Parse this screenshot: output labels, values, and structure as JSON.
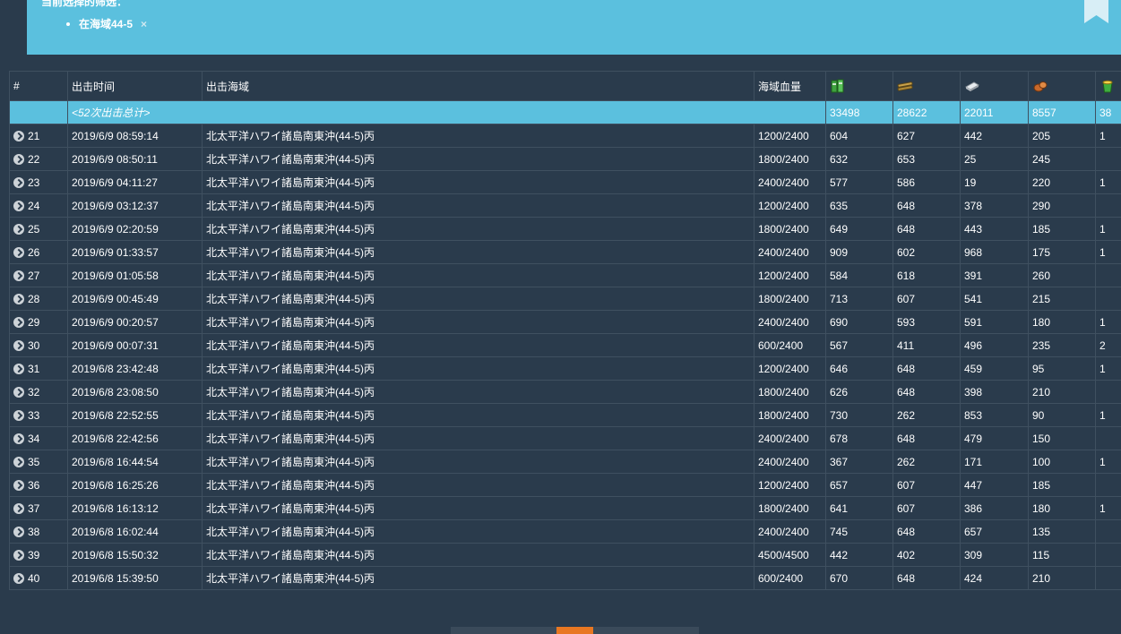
{
  "filter": {
    "title": "当前选择的筛选：",
    "items": [
      {
        "label": "在海域44-5",
        "remove": "×"
      }
    ]
  },
  "table": {
    "headers": {
      "index": "#",
      "time": "出击时间",
      "map": "出击海域",
      "hp": "海域血量",
      "fuel_icon": "fuel-icon",
      "ammo_icon": "ammo-icon",
      "steel_icon": "steel-icon",
      "bauxite_icon": "bauxite-icon",
      "bucket_icon": "bucket-icon"
    },
    "summary": {
      "label": "<52次出击总计>",
      "fuel": "33498",
      "ammo": "28622",
      "steel": "22011",
      "bauxite": "8557",
      "bucket": "38"
    },
    "rows": [
      {
        "index": "21",
        "time": "2019/6/9 08:59:14",
        "map": "北太平洋ハワイ諸島南東沖(44-5)丙",
        "hp": "1200/2400",
        "fuel": "604",
        "ammo": "627",
        "steel": "442",
        "bauxite": "205",
        "bucket": "1"
      },
      {
        "index": "22",
        "time": "2019/6/9 08:50:11",
        "map": "北太平洋ハワイ諸島南東沖(44-5)丙",
        "hp": "1800/2400",
        "fuel": "632",
        "ammo": "653",
        "steel": "25",
        "bauxite": "245",
        "bucket": ""
      },
      {
        "index": "23",
        "time": "2019/6/9 04:11:27",
        "map": "北太平洋ハワイ諸島南東沖(44-5)丙",
        "hp": "2400/2400",
        "fuel": "577",
        "ammo": "586",
        "steel": "19",
        "bauxite": "220",
        "bucket": "1"
      },
      {
        "index": "24",
        "time": "2019/6/9 03:12:37",
        "map": "北太平洋ハワイ諸島南東沖(44-5)丙",
        "hp": "1200/2400",
        "fuel": "635",
        "ammo": "648",
        "steel": "378",
        "bauxite": "290",
        "bucket": ""
      },
      {
        "index": "25",
        "time": "2019/6/9 02:20:59",
        "map": "北太平洋ハワイ諸島南東沖(44-5)丙",
        "hp": "1800/2400",
        "fuel": "649",
        "ammo": "648",
        "steel": "443",
        "bauxite": "185",
        "bucket": "1"
      },
      {
        "index": "26",
        "time": "2019/6/9 01:33:57",
        "map": "北太平洋ハワイ諸島南東沖(44-5)丙",
        "hp": "2400/2400",
        "fuel": "909",
        "ammo": "602",
        "steel": "968",
        "bauxite": "175",
        "bucket": "1"
      },
      {
        "index": "27",
        "time": "2019/6/9 01:05:58",
        "map": "北太平洋ハワイ諸島南東沖(44-5)丙",
        "hp": "1200/2400",
        "fuel": "584",
        "ammo": "618",
        "steel": "391",
        "bauxite": "260",
        "bucket": ""
      },
      {
        "index": "28",
        "time": "2019/6/9 00:45:49",
        "map": "北太平洋ハワイ諸島南東沖(44-5)丙",
        "hp": "1800/2400",
        "fuel": "713",
        "ammo": "607",
        "steel": "541",
        "bauxite": "215",
        "bucket": ""
      },
      {
        "index": "29",
        "time": "2019/6/9 00:20:57",
        "map": "北太平洋ハワイ諸島南東沖(44-5)丙",
        "hp": "2400/2400",
        "fuel": "690",
        "ammo": "593",
        "steel": "591",
        "bauxite": "180",
        "bucket": "1"
      },
      {
        "index": "30",
        "time": "2019/6/9 00:07:31",
        "map": "北太平洋ハワイ諸島南東沖(44-5)丙",
        "hp": "600/2400",
        "fuel": "567",
        "ammo": "411",
        "steel": "496",
        "bauxite": "235",
        "bucket": "2"
      },
      {
        "index": "31",
        "time": "2019/6/8 23:42:48",
        "map": "北太平洋ハワイ諸島南東沖(44-5)丙",
        "hp": "1200/2400",
        "fuel": "646",
        "ammo": "648",
        "steel": "459",
        "bauxite": "95",
        "bucket": "1"
      },
      {
        "index": "32",
        "time": "2019/6/8 23:08:50",
        "map": "北太平洋ハワイ諸島南東沖(44-5)丙",
        "hp": "1800/2400",
        "fuel": "626",
        "ammo": "648",
        "steel": "398",
        "bauxite": "210",
        "bucket": ""
      },
      {
        "index": "33",
        "time": "2019/6/8 22:52:55",
        "map": "北太平洋ハワイ諸島南東沖(44-5)丙",
        "hp": "1800/2400",
        "fuel": "730",
        "ammo": "262",
        "steel": "853",
        "bauxite": "90",
        "bucket": "1"
      },
      {
        "index": "34",
        "time": "2019/6/8 22:42:56",
        "map": "北太平洋ハワイ諸島南東沖(44-5)丙",
        "hp": "2400/2400",
        "fuel": "678",
        "ammo": "648",
        "steel": "479",
        "bauxite": "150",
        "bucket": ""
      },
      {
        "index": "35",
        "time": "2019/6/8 16:44:54",
        "map": "北太平洋ハワイ諸島南東沖(44-5)丙",
        "hp": "2400/2400",
        "fuel": "367",
        "ammo": "262",
        "steel": "171",
        "bauxite": "100",
        "bucket": "1"
      },
      {
        "index": "36",
        "time": "2019/6/8 16:25:26",
        "map": "北太平洋ハワイ諸島南東沖(44-5)丙",
        "hp": "1200/2400",
        "fuel": "657",
        "ammo": "607",
        "steel": "447",
        "bauxite": "185",
        "bucket": ""
      },
      {
        "index": "37",
        "time": "2019/6/8 16:13:12",
        "map": "北太平洋ハワイ諸島南東沖(44-5)丙",
        "hp": "1800/2400",
        "fuel": "641",
        "ammo": "607",
        "steel": "386",
        "bauxite": "180",
        "bucket": "1"
      },
      {
        "index": "38",
        "time": "2019/6/8 16:02:44",
        "map": "北太平洋ハワイ諸島南東沖(44-5)丙",
        "hp": "2400/2400",
        "fuel": "745",
        "ammo": "648",
        "steel": "657",
        "bauxite": "135",
        "bucket": ""
      },
      {
        "index": "39",
        "time": "2019/6/8 15:50:32",
        "map": "北太平洋ハワイ諸島南東沖(44-5)丙",
        "hp": "4500/4500",
        "fuel": "442",
        "ammo": "402",
        "steel": "309",
        "bauxite": "115",
        "bucket": ""
      },
      {
        "index": "40",
        "time": "2019/6/8 15:39:50",
        "map": "北太平洋ハワイ諸島南東沖(44-5)丙",
        "hp": "600/2400",
        "fuel": "670",
        "ammo": "648",
        "steel": "424",
        "bauxite": "210",
        "bucket": ""
      }
    ]
  },
  "colors": {
    "background": "#2a3b4c",
    "accent": "#5bc0de",
    "pager_active": "#e87722"
  }
}
